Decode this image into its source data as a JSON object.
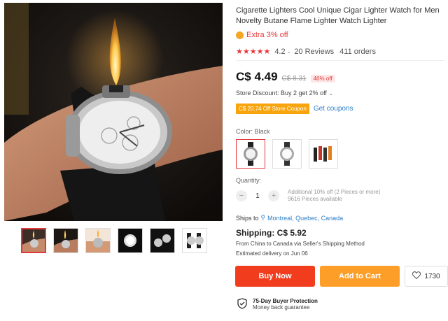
{
  "product": {
    "title": "Cigarette Lighters Cool Unique Cigar Lighter Watch for Men Novelty Butane Flame Lighter Watch Lighter",
    "extra_offer": "Extra 3% off",
    "rating_value": "4.2",
    "reviews": "20 Reviews",
    "orders": "411 orders",
    "price_now": "C$ 4.49",
    "price_old": "C$ 8.31",
    "price_discount": "46% off",
    "store_discount": "Store Discount: Buy 2 get 2% off",
    "coupon": "C$ 20.74 Off Store Coupon",
    "get_coupons": "Get coupons",
    "color_label": "Color: Black",
    "quantity_label": "Quantity:",
    "quantity_value": "1",
    "qty_note_line1": "Additional 10% off (2 Pieces or more)",
    "qty_note_line2": "9616 Pieces available",
    "ships_to_label": "Ships to",
    "ships_to_location": "Montreal, Quebec, Canada",
    "shipping_cost": "Shipping: C$ 5.92",
    "shipping_route": "From China to Canada via Seller's Shipping Method",
    "delivery": "Estimated delivery on Jun 06",
    "buy_now": "Buy Now",
    "add_to_cart": "Add to Cart",
    "wishlist_count": "1730",
    "protection_title": "75-Day Buyer Protection",
    "protection_sub": "Money back guarantee"
  },
  "icons": {
    "coin": "coin-icon",
    "location": "location-pin-icon",
    "heart": "heart-icon",
    "shield": "shield-check-icon"
  },
  "colors": {
    "accent_red": "#e4393c",
    "buy_now": "#f23c1e",
    "add_to_cart": "#fd9e29",
    "coupon": "#f7a40d",
    "link": "#2c7fc7"
  }
}
